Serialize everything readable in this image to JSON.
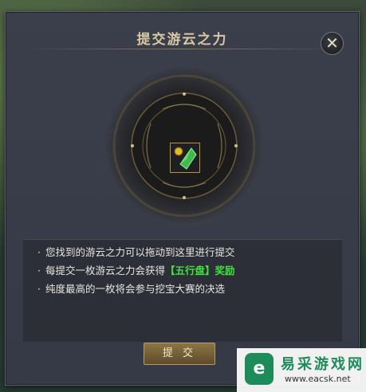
{
  "dialog": {
    "title": "提交游云之力",
    "close_glyph": "✕",
    "info_lines": [
      {
        "text": "您找到的游云之力可以拖动到这里进行提交"
      },
      {
        "text": "每提交一枚游云之力会获得",
        "highlight": "【五行盘】奖励"
      },
      {
        "text": "纯度最高的一枚将会参与挖宝大赛的决选"
      }
    ],
    "bullet": "·",
    "submit_label": "提 交"
  },
  "watermark": {
    "logo_glyph": "e",
    "name": "易采游戏网",
    "url": "www.eacsk.net"
  },
  "colors": {
    "highlight_green": "#3fe23a",
    "title_gold": "#d9c9a2",
    "slot_border": "#b6913e"
  },
  "icons": {
    "item": "green-crystal-icon",
    "badge": "gold-rank-icon"
  }
}
